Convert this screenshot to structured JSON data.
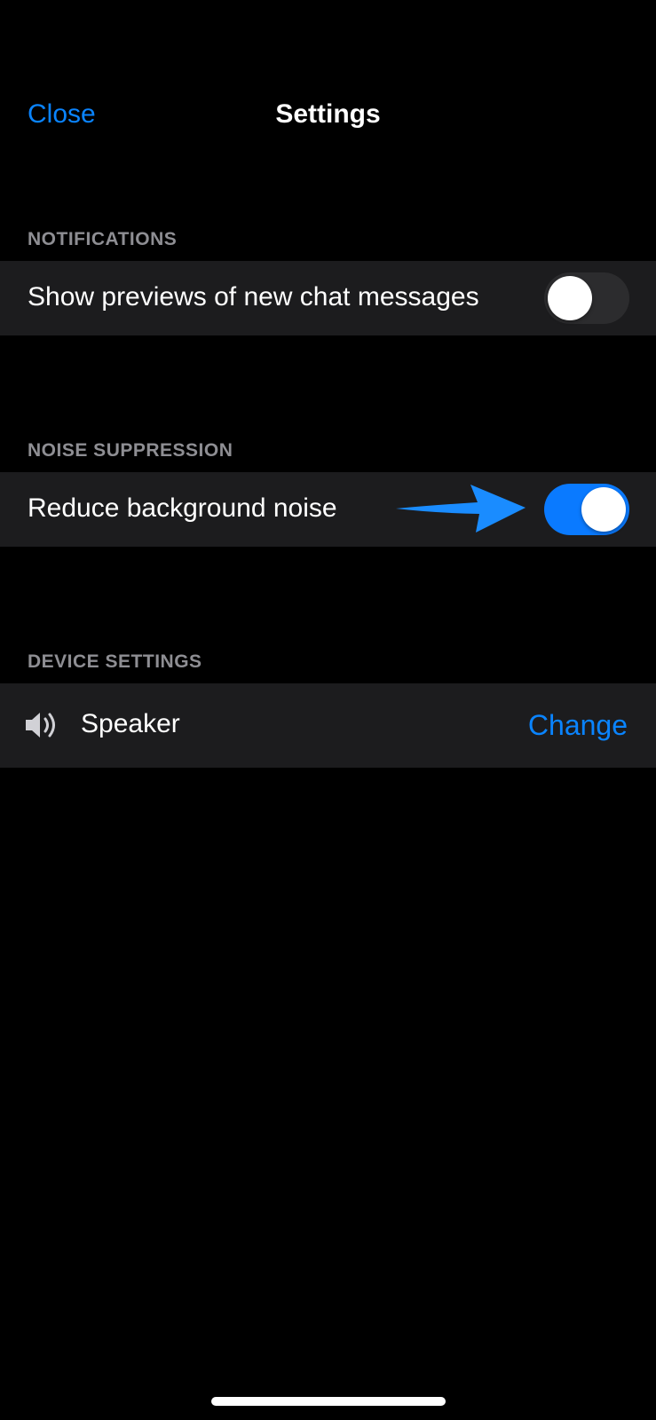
{
  "nav": {
    "close_label": "Close",
    "title": "Settings"
  },
  "sections": {
    "notifications": {
      "header": "NOTIFICATIONS",
      "row_label": "Show previews of new chat messages",
      "toggle_on": false
    },
    "noise_suppression": {
      "header": "NOISE SUPPRESSION",
      "row_label": "Reduce background noise",
      "toggle_on": true
    },
    "device_settings": {
      "header": "DEVICE SETTINGS",
      "device_label": "Speaker",
      "change_label": "Change"
    }
  },
  "icons": {
    "speaker": "speaker-icon",
    "annotation": "arrow-icon"
  },
  "colors": {
    "background": "#000000",
    "row_background": "#1c1c1e",
    "accent": "#0a84ff",
    "toggle_on": "#0a7aff",
    "toggle_off": "#2c2c2e",
    "header_text": "#8e8e93",
    "annotation_arrow": "#1a8cff"
  }
}
